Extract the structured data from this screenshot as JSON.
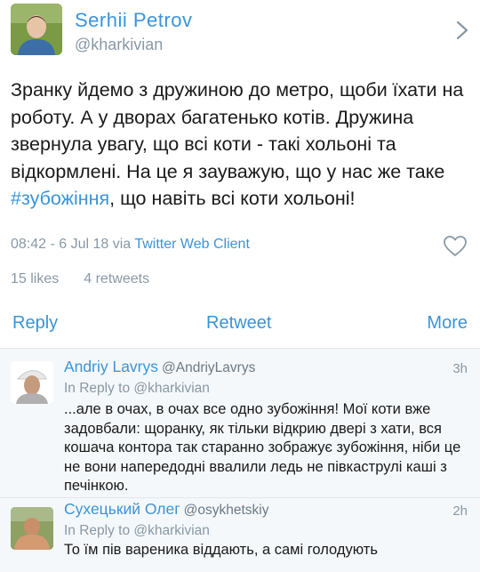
{
  "tweet": {
    "author_name": "Serhii Petrov",
    "author_handle": "@kharkivian",
    "text_before": "Зранку йдемо з дружиною до метро, щоби їхати на роботу. А у дворах багатенько котів. Дружина звернула увагу, що всі коти - такі хольоні та відкормлені. На це я зауважую, що у нас же таке ",
    "hashtag": "#зубожіння",
    "text_after": ", що навіть всі коти хольоні!",
    "timestamp": "08:42 - 6 Jul 18 via ",
    "client": "Twitter Web Client",
    "likes": "15 likes",
    "retweets": "4 retweets"
  },
  "actions": {
    "reply": "Reply",
    "retweet": "Retweet",
    "more": "More"
  },
  "replies": [
    {
      "name": "Andriy Lavrys",
      "handle": "@AndriyLavrys",
      "time": "3h",
      "in_reply_prefix": "In Reply to ",
      "in_reply_handle": "@kharkivian",
      "text": "...але в очах, в очах все одно зубожіння! Мої коти вже задовбали: щоранку, як тільки відкрию двері з хати, вся кошача контора так старанно зображує зубожіння, ніби це не вони напередодні ввалили ледь не півкаструлі каші з печінкою."
    },
    {
      "name": "Сухецький Олег",
      "handle": "@osykhetskiy",
      "time": "2h",
      "in_reply_prefix": "In Reply to ",
      "in_reply_handle": "@kharkivian",
      "text": "То їм пів вареника віддають, а самі голодують"
    }
  ],
  "colors": {
    "link_blue": "#3b94d9",
    "muted_gray": "#8899a6",
    "reply_background": "#f5f8fa",
    "divider": "#e1e8ed"
  },
  "icons": {
    "chevron": "chevron-right-icon",
    "like": "heart-outline-icon"
  }
}
